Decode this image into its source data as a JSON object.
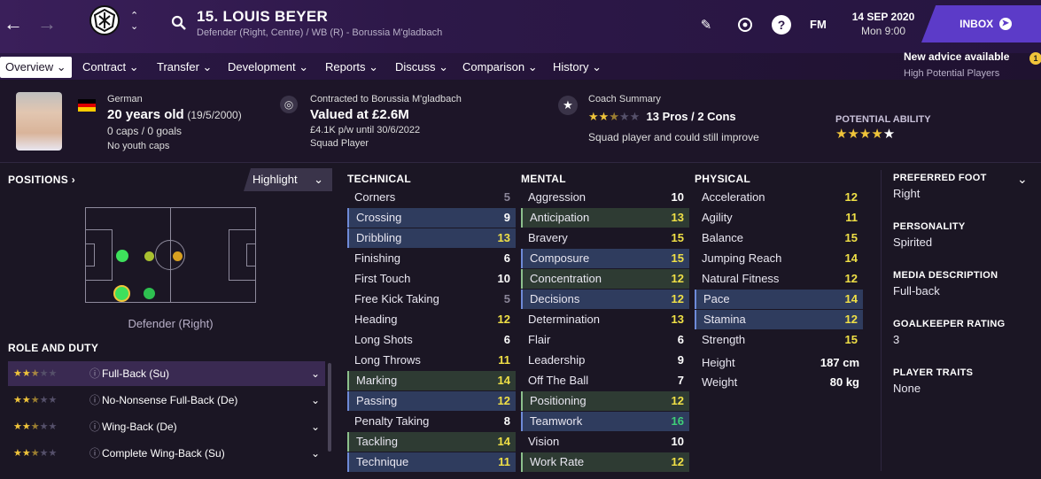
{
  "nav": {
    "back_icon": "arrow-left-icon",
    "forward_icon": "arrow-right-icon"
  },
  "player": {
    "title": "15. LOUIS BEYER",
    "subtitle": "Defender (Right, Centre) / WB (R) - Borussia M'gladbach"
  },
  "date": {
    "day": "14 SEP 2020",
    "time": "Mon 9:00"
  },
  "inbox": {
    "label": "INBOX"
  },
  "fm_label": "FM",
  "tabs": [
    {
      "label": "Overview"
    },
    {
      "label": "Contract"
    },
    {
      "label": "Transfer"
    },
    {
      "label": "Development"
    },
    {
      "label": "Reports"
    },
    {
      "label": "Discuss"
    },
    {
      "label": "Comparison"
    },
    {
      "label": "History"
    }
  ],
  "advice": {
    "title": "New advice available",
    "sub": "High Potential Players",
    "count": "1"
  },
  "bio": {
    "nation": "German",
    "age": "20 years old",
    "dob": "(19/5/2000)",
    "caps": "0 caps / 0 goals",
    "youth": "No youth caps"
  },
  "contract": {
    "label": "Contracted to Borussia M'gladbach",
    "value": "Valued at £2.6M",
    "wage": "£4.1K p/w until 30/6/2022",
    "status": "Squad Player"
  },
  "coach": {
    "label": "Coach Summary",
    "pros": "13 Pros / 2 Cons",
    "summary": "Squad player and could still improve",
    "stars": 2.5
  },
  "potential": {
    "label": "POTENTIAL ABILITY",
    "stars": 4.5
  },
  "positions": {
    "title": "POSITIONS",
    "highlight": "Highlight",
    "caption": "Defender (Right)"
  },
  "role_duty": {
    "title": "ROLE AND DUTY",
    "roles": [
      {
        "label": "Full-Back (Su)",
        "stars": 2.5
      },
      {
        "label": "No-Nonsense Full-Back (De)",
        "stars": 2.5
      },
      {
        "label": "Wing-Back (De)",
        "stars": 2.5
      },
      {
        "label": "Complete Wing-Back (Su)",
        "stars": 2.5
      }
    ]
  },
  "technical": {
    "title": "TECHNICAL",
    "attrs": [
      [
        "Corners",
        "5"
      ],
      [
        "Crossing",
        "9"
      ],
      [
        "Dribbling",
        "13"
      ],
      [
        "Finishing",
        "6"
      ],
      [
        "First Touch",
        "10"
      ],
      [
        "Free Kick Taking",
        "5"
      ],
      [
        "Heading",
        "12"
      ],
      [
        "Long Shots",
        "6"
      ],
      [
        "Long Throws",
        "11"
      ],
      [
        "Marking",
        "14"
      ],
      [
        "Passing",
        "12"
      ],
      [
        "Penalty Taking",
        "8"
      ],
      [
        "Tackling",
        "14"
      ],
      [
        "Technique",
        "11"
      ]
    ]
  },
  "mental": {
    "title": "MENTAL",
    "attrs": [
      [
        "Aggression",
        "10"
      ],
      [
        "Anticipation",
        "13"
      ],
      [
        "Bravery",
        "15"
      ],
      [
        "Composure",
        "15"
      ],
      [
        "Concentration",
        "12"
      ],
      [
        "Decisions",
        "12"
      ],
      [
        "Determination",
        "13"
      ],
      [
        "Flair",
        "6"
      ],
      [
        "Leadership",
        "9"
      ],
      [
        "Off The Ball",
        "7"
      ],
      [
        "Positioning",
        "12"
      ],
      [
        "Teamwork",
        "16"
      ],
      [
        "Vision",
        "10"
      ],
      [
        "Work Rate",
        "12"
      ]
    ]
  },
  "physical": {
    "title": "PHYSICAL",
    "attrs": [
      [
        "Acceleration",
        "12"
      ],
      [
        "Agility",
        "11"
      ],
      [
        "Balance",
        "15"
      ],
      [
        "Jumping Reach",
        "14"
      ],
      [
        "Natural Fitness",
        "12"
      ],
      [
        "Pace",
        "14"
      ],
      [
        "Stamina",
        "12"
      ],
      [
        "Strength",
        "15"
      ]
    ],
    "height_label": "Height",
    "height": "187 cm",
    "weight_label": "Weight",
    "weight": "80 kg"
  },
  "right": {
    "foot_label": "PREFERRED FOOT",
    "foot": "Right",
    "personality_label": "PERSONALITY",
    "personality": "Spirited",
    "media_label": "MEDIA DESCRIPTION",
    "media": "Full-back",
    "gk_label": "GOALKEEPER RATING",
    "gk": "3",
    "traits_label": "PLAYER TRAITS",
    "traits": "None"
  }
}
